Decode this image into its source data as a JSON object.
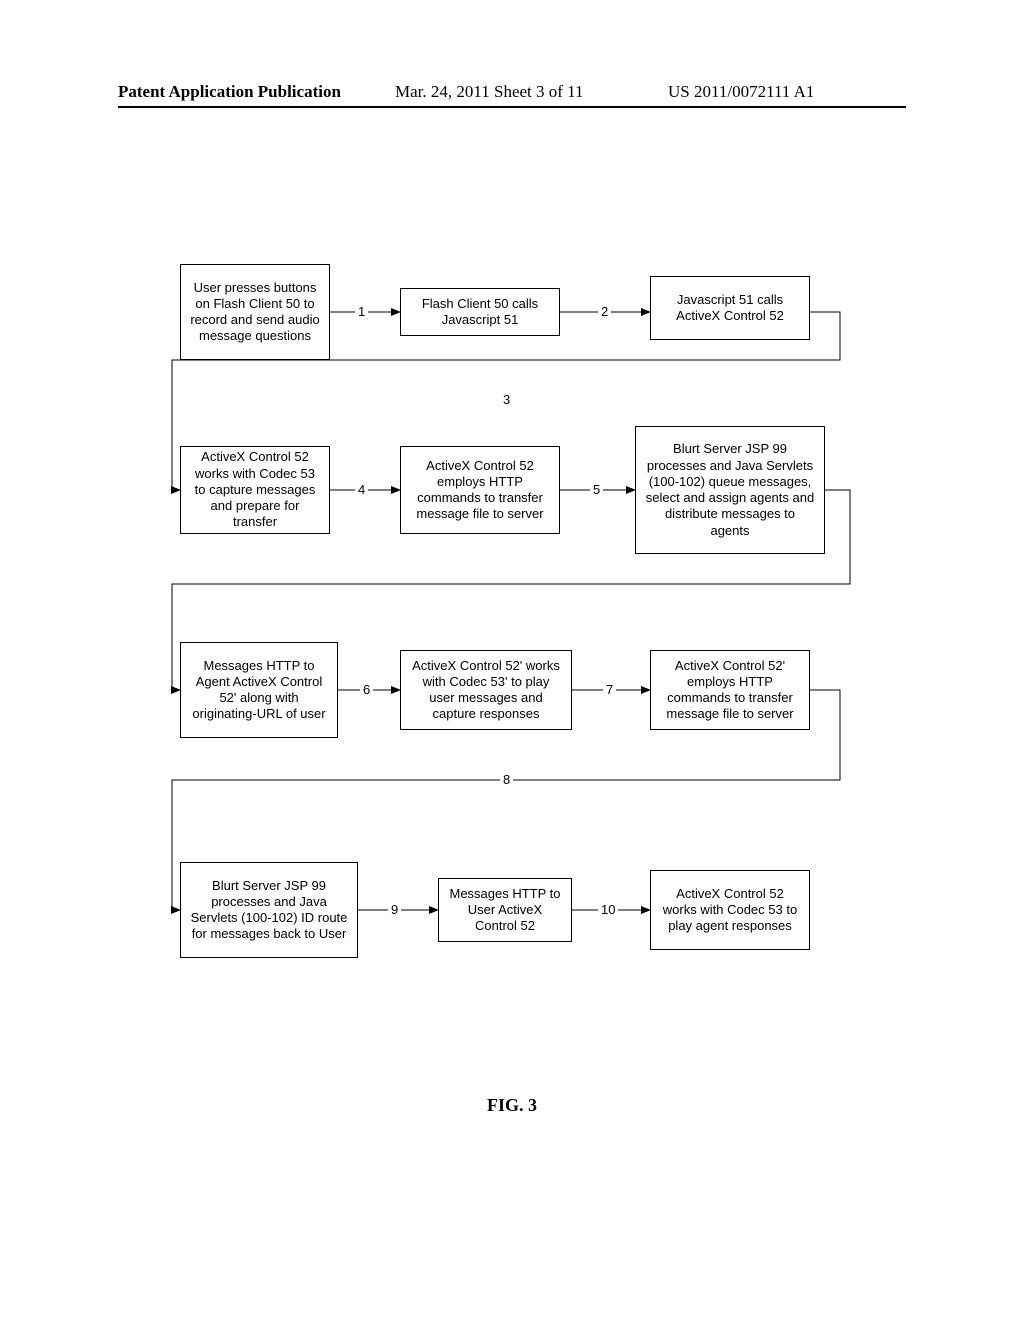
{
  "header": {
    "left": "Patent Application Publication",
    "mid": "Mar. 24, 2011  Sheet 3 of 11",
    "right": "US 2011/0072111 A1"
  },
  "figure_caption": "FIG. 3",
  "boxes": {
    "b1": "User presses buttons on Flash Client 50 to record and send audio message questions",
    "b2": "Flash Client 50 calls Javascript 51",
    "b3": "Javascript 51 calls ActiveX Control 52",
    "b4": "ActiveX Control 52 works with Codec 53 to capture messages and prepare for transfer",
    "b5": "ActiveX Control 52 employs HTTP commands to transfer message file to server",
    "b6": "Blurt Server JSP 99 processes and Java Servlets (100-102) queue messages, select and assign agents and distribute messages to agents",
    "b7": "Messages HTTP to Agent ActiveX Control 52' along with originating-URL of user",
    "b8": "ActiveX Control 52' works with Codec 53' to play user messages and capture responses",
    "b9": "ActiveX Control 52' employs HTTP commands to transfer message file to server",
    "b10": "Blurt Server JSP 99 processes and Java Servlets (100-102) ID route for messages back to User",
    "b11": "Messages HTTP to User ActiveX Control 52",
    "b12": "ActiveX Control 52 works with Codec 53 to play agent responses"
  },
  "arrow_labels": {
    "a1": "1",
    "a2": "2",
    "a3": "3",
    "a4": "4",
    "a5": "5",
    "a6": "6",
    "a7": "7",
    "a8": "8",
    "a9": "9",
    "a10": "10"
  },
  "chart_data": {
    "type": "flowchart",
    "nodes": [
      {
        "id": "b1",
        "text": "User presses buttons on Flash Client 50 to record and send audio message questions"
      },
      {
        "id": "b2",
        "text": "Flash Client 50 calls Javascript 51"
      },
      {
        "id": "b3",
        "text": "Javascript 51 calls ActiveX Control 52"
      },
      {
        "id": "b4",
        "text": "ActiveX Control 52 works with Codec 53 to capture messages and prepare for transfer"
      },
      {
        "id": "b5",
        "text": "ActiveX Control 52 employs HTTP commands to transfer message file to server"
      },
      {
        "id": "b6",
        "text": "Blurt Server JSP 99 processes and Java Servlets (100-102) queue messages, select and assign agents and distribute messages to agents"
      },
      {
        "id": "b7",
        "text": "Messages HTTP to Agent ActiveX Control 52' along with originating-URL of user"
      },
      {
        "id": "b8",
        "text": "ActiveX Control 52' works with Codec 53' to play user messages and capture responses"
      },
      {
        "id": "b9",
        "text": "ActiveX Control 52' employs HTTP commands to transfer message file to server"
      },
      {
        "id": "b10",
        "text": "Blurt Server JSP 99 processes and Java Servlets (100-102) ID route for messages back to User"
      },
      {
        "id": "b11",
        "text": "Messages HTTP to User ActiveX Control 52"
      },
      {
        "id": "b12",
        "text": "ActiveX Control 52 works with Codec 53 to play agent responses"
      }
    ],
    "edges": [
      {
        "from": "b1",
        "to": "b2",
        "label": "1"
      },
      {
        "from": "b2",
        "to": "b3",
        "label": "2"
      },
      {
        "from": "b3",
        "to": "b4",
        "label": "3"
      },
      {
        "from": "b4",
        "to": "b5",
        "label": "4"
      },
      {
        "from": "b5",
        "to": "b6",
        "label": "5"
      },
      {
        "from": "b6",
        "to": "b7",
        "label": "6"
      },
      {
        "from": "b7",
        "to": "b8",
        "label": "6"
      },
      {
        "from": "b8",
        "to": "b9",
        "label": "7"
      },
      {
        "from": "b9",
        "to": "b10",
        "label": "8"
      },
      {
        "from": "b10",
        "to": "b11",
        "label": "9"
      },
      {
        "from": "b11",
        "to": "b12",
        "label": "10"
      }
    ]
  }
}
